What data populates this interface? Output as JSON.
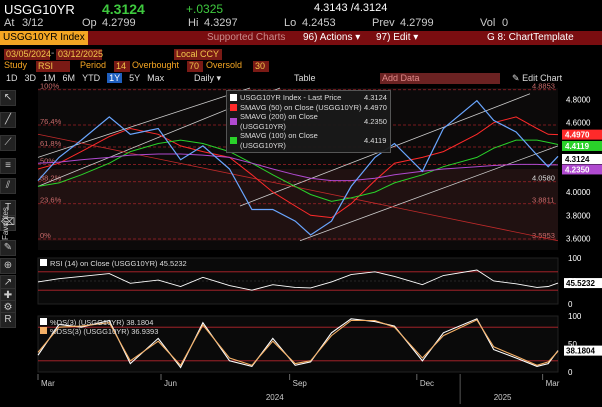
{
  "header": {
    "ticker": "USGG10YR",
    "last": "4.3124",
    "change": "+.0325",
    "bid_ask": "4.3143 /4.3124",
    "time_label": "At",
    "time": "3/12",
    "open_label": "Op",
    "open": "4.2799",
    "high_label": "Hi",
    "high": "4.3297",
    "low_label": "Lo",
    "low": "4.2453",
    "prev_label": "Prev",
    "prev": "4.2799",
    "vol_label": "Vol",
    "vol": "0"
  },
  "toolbar": {
    "security": "USGG10YR Index",
    "supported_charts": "Supported Charts",
    "actions": "Actions",
    "actions_key": "96)",
    "edit": "Edit",
    "edit_key": "97)",
    "template": "G 8: ChartTemplate",
    "date_from": "03/05/2024",
    "date_to": "03/12/2025",
    "currency": "Local CCY",
    "study_label": "Study",
    "study": "RSI",
    "period_label": "Period",
    "period": "14",
    "overbought_label": "Overbought",
    "overbought": "70",
    "oversold_label": "Oversold",
    "oversold": "30",
    "ranges": [
      "1D",
      "3D",
      "1M",
      "6M",
      "YTD",
      "1Y",
      "5Y",
      "Max"
    ],
    "active_range": "1Y",
    "freq": "Daily",
    "table": "Table",
    "add_data": "Add Data",
    "edit_chart": "Edit Chart"
  },
  "side": {
    "favorites": "Favorites"
  },
  "colors": {
    "price": "#ffffff",
    "sma50": "#ff2a2a",
    "sma200": "#b04ad0",
    "sma100": "#2ad22a",
    "rsi": "#ffffff",
    "stoch_k": "#f5b066",
    "stoch_d": "#ffffff",
    "bbg_orange": "#f5a623",
    "bbg_red": "#7a0d10"
  },
  "chart_data": [
    {
      "type": "line",
      "title": "USGG10YR Index",
      "legend": [
        {
          "name": "USGG10YR Index - Last Price",
          "value": "4.3124"
        },
        {
          "name": "SMAVG (50) on Close (USGG10YR)",
          "value": "4.4970"
        },
        {
          "name": "SMAVG (200) on Close (USGG10YR)",
          "value": "4.2350"
        },
        {
          "name": "SMAVG (100) on Close (USGG10YR)",
          "value": "4.4119"
        }
      ],
      "ylim": [
        3.5,
        4.9
      ],
      "y_ticks": [
        "4.8000",
        "4.6000",
        "4.4000",
        "4.2000",
        "4.0000",
        "3.8000",
        "3.6000"
      ],
      "fib_labels": [
        "100%",
        "76.4%",
        "61.8%",
        "50%",
        "38.2%",
        "23.6%",
        "0%"
      ],
      "fib_values": [
        "4.8853",
        "4.0580",
        "3.8811",
        "3.5953"
      ],
      "price_tags": [
        {
          "value": "4.4970",
          "color": "#ff2a2a"
        },
        {
          "value": "4.4119",
          "color": "#2ad22a"
        },
        {
          "value": "4.3124",
          "color": "#ffffff"
        },
        {
          "value": "4.2350",
          "color": "#b04ad0"
        }
      ],
      "x": [
        "2024-03-05",
        "2024-03-20",
        "2024-04-05",
        "2024-04-25",
        "2024-05-10",
        "2024-05-30",
        "2024-06-15",
        "2024-07-01",
        "2024-07-20",
        "2024-08-05",
        "2024-08-20",
        "2024-09-05",
        "2024-09-16",
        "2024-10-01",
        "2024-10-15",
        "2024-11-01",
        "2024-11-15",
        "2024-12-05",
        "2024-12-20",
        "2025-01-13",
        "2025-01-25",
        "2025-02-10",
        "2025-02-25",
        "2025-03-05",
        "2025-03-12"
      ],
      "series": [
        {
          "name": "USGG10YR Index - Last Price",
          "values": [
            4.1,
            4.3,
            4.45,
            4.65,
            4.5,
            4.55,
            4.28,
            4.4,
            4.2,
            3.85,
            3.85,
            3.75,
            3.63,
            3.75,
            4.05,
            4.3,
            4.42,
            4.18,
            4.55,
            4.79,
            4.62,
            4.52,
            4.32,
            4.22,
            4.31
          ]
        },
        {
          "name": "SMAVG (50) on Close (USGG10YR)",
          "values": [
            4.2,
            4.25,
            4.35,
            4.48,
            4.55,
            4.5,
            4.4,
            4.35,
            4.3,
            4.15,
            4.0,
            3.88,
            3.8,
            3.78,
            3.9,
            4.1,
            4.25,
            4.3,
            4.35,
            4.5,
            4.6,
            4.65,
            4.55,
            4.5,
            4.497
          ]
        },
        {
          "name": "SMAVG (100) on Close (USGG10YR)",
          "values": [
            4.05,
            4.08,
            4.15,
            4.25,
            4.35,
            4.42,
            4.45,
            4.42,
            4.35,
            4.25,
            4.15,
            4.05,
            3.98,
            3.92,
            3.95,
            4.0,
            4.08,
            4.15,
            4.22,
            4.3,
            4.38,
            4.45,
            4.45,
            4.43,
            4.412
          ]
        },
        {
          "name": "SMAVG (200) on Close (USGG10YR)",
          "values": [
            4.25,
            4.26,
            4.28,
            4.3,
            4.32,
            4.33,
            4.33,
            4.32,
            4.3,
            4.25,
            4.2,
            4.15,
            4.12,
            4.1,
            4.1,
            4.12,
            4.15,
            4.18,
            4.2,
            4.22,
            4.23,
            4.24,
            4.24,
            4.235,
            4.235
          ]
        }
      ]
    },
    {
      "type": "line",
      "title": "RSI (14) on Close (USGG10YR)",
      "value": "45.5232",
      "ylim": [
        0,
        100
      ],
      "y_ticks": [
        "100",
        "50",
        "0"
      ],
      "series": [
        {
          "name": "RSI (14) on Close (USGG10YR)",
          "values": [
            48,
            55,
            60,
            66,
            45,
            52,
            38,
            58,
            40,
            30,
            42,
            36,
            35,
            48,
            64,
            70,
            60,
            42,
            62,
            74,
            50,
            44,
            36,
            38,
            45.5
          ]
        }
      ]
    },
    {
      "type": "line",
      "title": "%DS(3) / %DSS(3)",
      "ylim": [
        0,
        100
      ],
      "y_ticks": [
        "100",
        "50",
        "0"
      ],
      "values_label": [
        "38.1804",
        "36.9393"
      ],
      "x_ticks": [
        "Mar",
        "Jun",
        "Sep",
        "Dec",
        "Mar"
      ],
      "year_labels": [
        "2024",
        "2025"
      ],
      "series": [
        {
          "name": "%DS(3) (USGG10YR)",
          "values": [
            30,
            85,
            80,
            92,
            15,
            60,
            8,
            88,
            20,
            10,
            60,
            12,
            18,
            70,
            95,
            90,
            82,
            20,
            70,
            95,
            40,
            25,
            10,
            15,
            38.18
          ]
        },
        {
          "name": "%DSS(3) (USGG10YR)",
          "values": [
            35,
            80,
            82,
            88,
            20,
            55,
            12,
            84,
            25,
            12,
            55,
            15,
            20,
            65,
            92,
            92,
            80,
            25,
            65,
            93,
            45,
            28,
            12,
            18,
            36.94
          ]
        }
      ]
    }
  ]
}
